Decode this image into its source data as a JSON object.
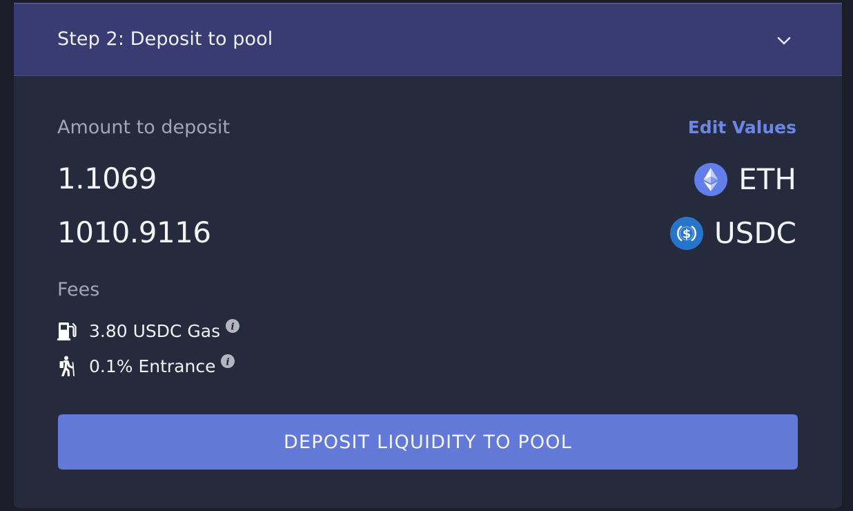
{
  "header": {
    "title": "Step 2: Deposit to pool",
    "toggle_icon": "chevron-down-icon"
  },
  "deposit": {
    "label": "Amount to deposit",
    "edit_label": "Edit Values",
    "tokens": [
      {
        "amount": "1.1069",
        "symbol": "ETH",
        "icon": "ethereum-icon"
      },
      {
        "amount": "1010.9116",
        "symbol": "USDC",
        "icon": "usdc-icon"
      }
    ]
  },
  "fees": {
    "label": "Fees",
    "items": [
      {
        "text": "3.80 USDC Gas",
        "icon": "gas-pump-icon",
        "info_icon": "info-icon"
      },
      {
        "text": "0.1% Entrance",
        "icon": "hiker-icon",
        "info_icon": "info-icon"
      }
    ]
  },
  "action": {
    "button_label": "DEPOSIT LIQUIDITY TO POOL"
  },
  "colors": {
    "background": "#262a3d",
    "header": "#383c72",
    "accent": "#6279d8",
    "link": "#6b86e6",
    "eth_icon": "#627eea",
    "usdc_icon": "#2775ca"
  }
}
